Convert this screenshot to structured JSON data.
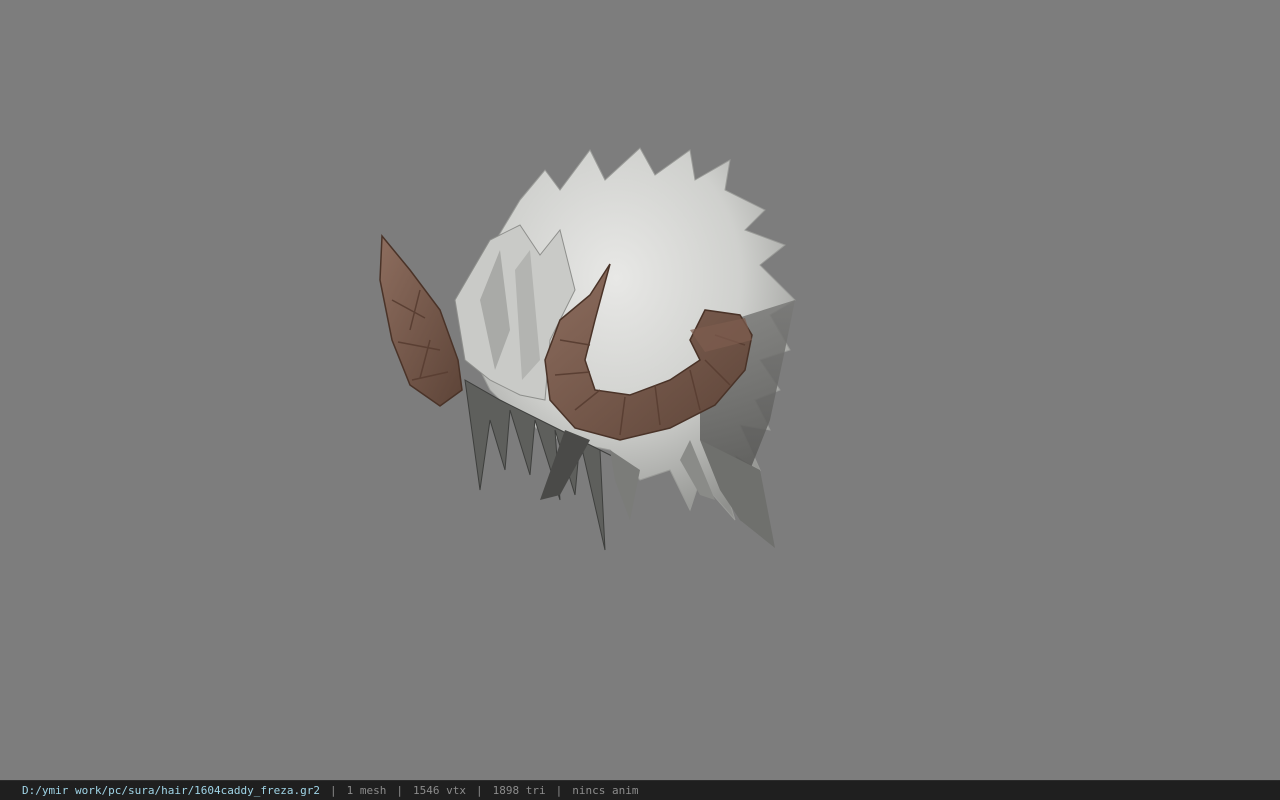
{
  "viewer": {
    "background_color": "#7d7d7d",
    "model_icon": "horned-hair-mesh"
  },
  "status_bar": {
    "file_path": "D:/ymir work/pc/sura/hair/1604caddy_freza.gr2",
    "separator": "|",
    "mesh_count": "1 mesh",
    "vertex_count": "1546 vtx",
    "triangle_count": "1898 tri",
    "animation": "nincs anim",
    "path_color": "#9fd4e6",
    "text_color": "#8c8c8c"
  }
}
